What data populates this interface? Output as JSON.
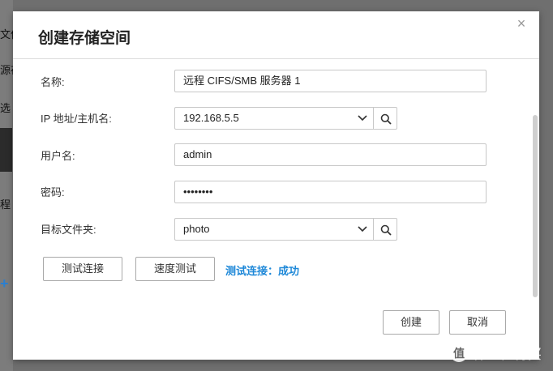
{
  "background": {
    "fragments": [
      "文件",
      "源存",
      "选",
      "程"
    ]
  },
  "dialog": {
    "title": "创建存储空间",
    "fields": {
      "name": {
        "label": "名称:",
        "value": "远程 CIFS/SMB 服务器 1"
      },
      "ip": {
        "label": "IP 地址/主机名:",
        "value": "192.168.5.5"
      },
      "username": {
        "label": "用户名:",
        "value": "admin"
      },
      "password": {
        "label": "密码:",
        "value": "••••••••"
      },
      "target_folder": {
        "label": "目标文件夹:",
        "value": "photo"
      }
    },
    "buttons": {
      "test_connection": "测试连接",
      "speed_test": "速度测试",
      "create": "创建",
      "cancel": "取消"
    },
    "status": "测试连接：成功"
  },
  "watermark": {
    "text": "什么值得买",
    "logo_glyph": "值"
  },
  "colors": {
    "status_blue": "#1e88d8",
    "overlay": "#6f6f6f"
  }
}
